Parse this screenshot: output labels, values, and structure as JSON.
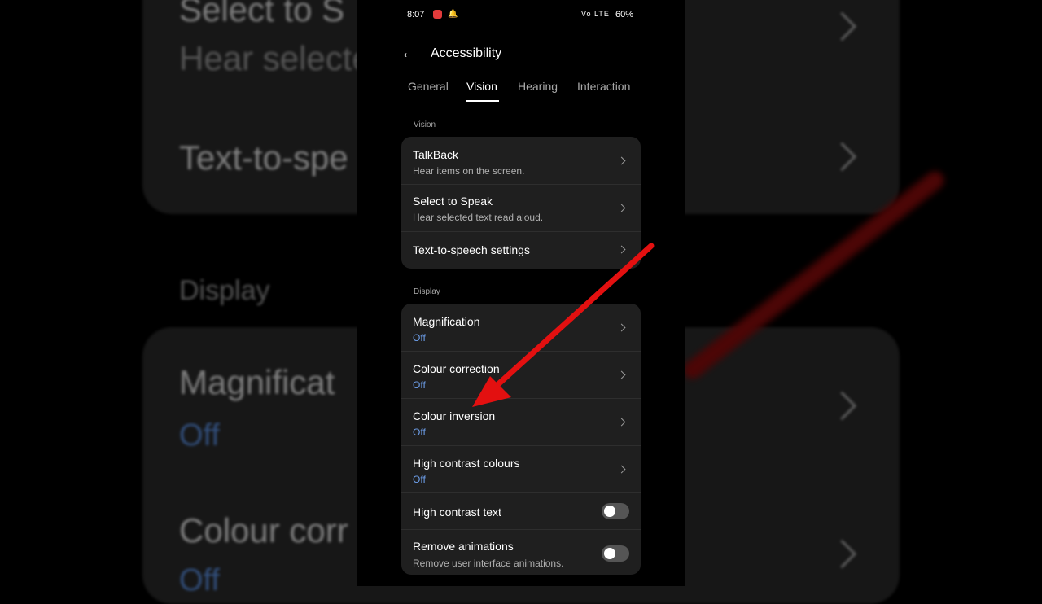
{
  "status": {
    "time": "8:07",
    "signal": "Vo LTE",
    "battery": "60%"
  },
  "header": {
    "title": "Accessibility"
  },
  "tabs": [
    {
      "label": "General"
    },
    {
      "label": "Vision"
    },
    {
      "label": "Hearing"
    },
    {
      "label": "Interaction"
    }
  ],
  "sections": {
    "vision": {
      "label": "Vision",
      "items": [
        {
          "label": "TalkBack",
          "sub": "Hear items on the screen."
        },
        {
          "label": "Select to Speak",
          "sub": "Hear selected text read aloud."
        },
        {
          "label": "Text-to-speech settings"
        }
      ]
    },
    "display": {
      "label": "Display",
      "items": [
        {
          "label": "Magnification",
          "sub": "Off"
        },
        {
          "label": "Colour correction",
          "sub": "Off"
        },
        {
          "label": "Colour inversion",
          "sub": "Off"
        },
        {
          "label": "High contrast colours",
          "sub": "Off"
        },
        {
          "label": "High contrast text",
          "toggle": false
        },
        {
          "label": "Remove animations",
          "sub": "Remove user interface animations.",
          "toggle": false
        }
      ]
    }
  },
  "background": {
    "line1": "Select to S",
    "line2": "Hear selecte",
    "line3": "Text-to-spe",
    "line4": "Display",
    "line5": "Magnificat",
    "line6": "Off",
    "line7": "Colour corr",
    "line8": "Off"
  },
  "colors": {
    "accent_off": "#6ea0ec",
    "arrow": "#e31010",
    "card": "#1f1f1f"
  }
}
